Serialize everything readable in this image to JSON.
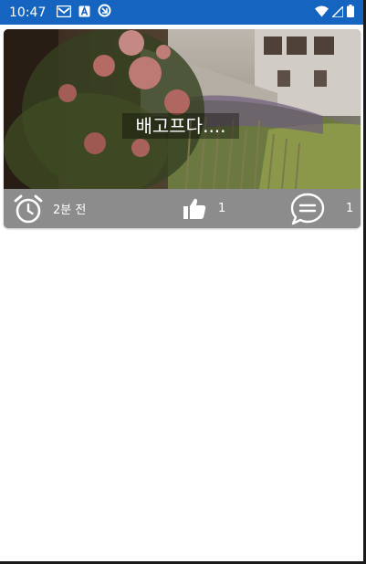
{
  "status_bar": {
    "time": "10:47",
    "background": "#1565c0",
    "left_icons": [
      "gmail-icon",
      "a-badge-icon",
      "data-saver-icon"
    ],
    "right_icons": [
      "wifi-icon",
      "cell-signal-icon",
      "battery-icon"
    ]
  },
  "post": {
    "title": "배고프다....",
    "time_ago": "2분 전",
    "likes": "1",
    "comments": "1",
    "footer_color": "#8c8c8c"
  }
}
